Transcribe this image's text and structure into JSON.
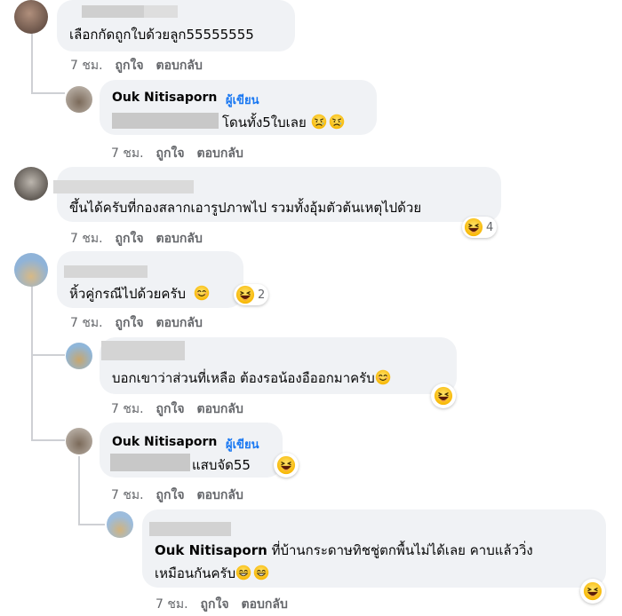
{
  "labels": {
    "time": "7 ชม.",
    "like": "ถูกใจ",
    "reply": "ตอบกลับ",
    "author_badge": "ผู้เขียน"
  },
  "comments": [
    {
      "text": "เลือกกัดถูกใบด้วยลูก55555555"
    },
    {
      "name": "Ouk Nitisaporn",
      "text": "โดนทั้ง5ใบเลย",
      "emoji": "😥😥"
    },
    {
      "text": "ขึ้นได้ครับที่กองสลากเอารูปภาพไป รวมทั้งอุ้มตัวต้นเหตุไปด้วย",
      "reaction_count": "4"
    },
    {
      "text": "หิ้วคู่กรณีไปด้วยครับ",
      "reaction_count": "2"
    },
    {
      "text": "บอกเขาว่าส่วนที่เหลือ ต้องรอน้องอืออกมาครับ"
    },
    {
      "name": "Ouk Nitisaporn",
      "text": "แสบจัด55"
    },
    {
      "mention": "Ouk Nitisaporn",
      "text": "ที่บ้านกระดาษทิชชู่ตกพื้นไม่ได้เลย คาบแล้ววิ่ง",
      "text2": "เหมือนกันครับ"
    }
  ],
  "colors": {
    "bubble": "#f0f2f5",
    "meta": "#65676b",
    "author": "#1877f2",
    "thread_line": "#ced0d4"
  },
  "icons": [
    "laughing-emoji-icon",
    "smiling-emoji-icon",
    "sad-emoji-icon",
    "grinning-emoji-icon"
  ]
}
